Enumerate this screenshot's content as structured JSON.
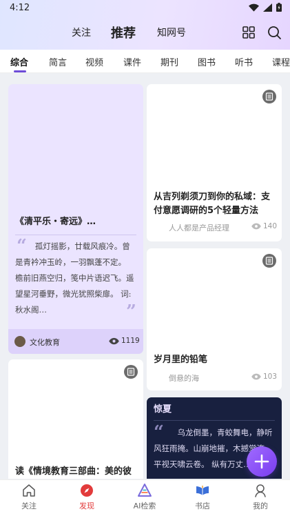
{
  "status": {
    "time": "4:12"
  },
  "header": {
    "tabs": [
      {
        "label": "关注"
      },
      {
        "label": "推荐"
      },
      {
        "label": "知网号"
      }
    ]
  },
  "categories": [
    "综合",
    "简言",
    "视频",
    "课件",
    "期刊",
    "图书",
    "听书",
    "课程"
  ],
  "cards": {
    "poem": {
      "title": "《清平乐・寄远》…",
      "quote": "孤灯摇影，廿载风痕冷。曾是青衿冲玉岭，一羽飘蓬不定。 檐前旧燕空归，笺中片语迟飞。遥望星河垂野，微光犹照柴扉。 词:秋水阁…",
      "author": "文化教育",
      "views": "1119"
    },
    "article1": {
      "title": "从吉列剃须刀到你的私域：支付意愿调研的5个轻量方法",
      "author": "人人都是产品经理",
      "views": "140"
    },
    "article2": {
      "title": "岁月里的铅笔",
      "author": "倒悬的海",
      "views": "103"
    },
    "article3": {
      "title": "读《情境教育三部曲：美的彼"
    },
    "dark": {
      "title": "惊夏",
      "quote": "乌龙倒墨，青蛟舞电，静听风狂雨掩。山崩地摧，木撼堂淹，平视天啸云卷。 纵有万丈…"
    }
  },
  "tabbar": [
    {
      "label": "关注"
    },
    {
      "label": "发现"
    },
    {
      "label": "AI检索"
    },
    {
      "label": "书店"
    },
    {
      "label": "我的"
    }
  ],
  "colors": {
    "accent": "#6d4bd8",
    "active_tab": "#e23b3b",
    "poem_card": "#ebe4ff",
    "dark_card": "#18203f"
  }
}
